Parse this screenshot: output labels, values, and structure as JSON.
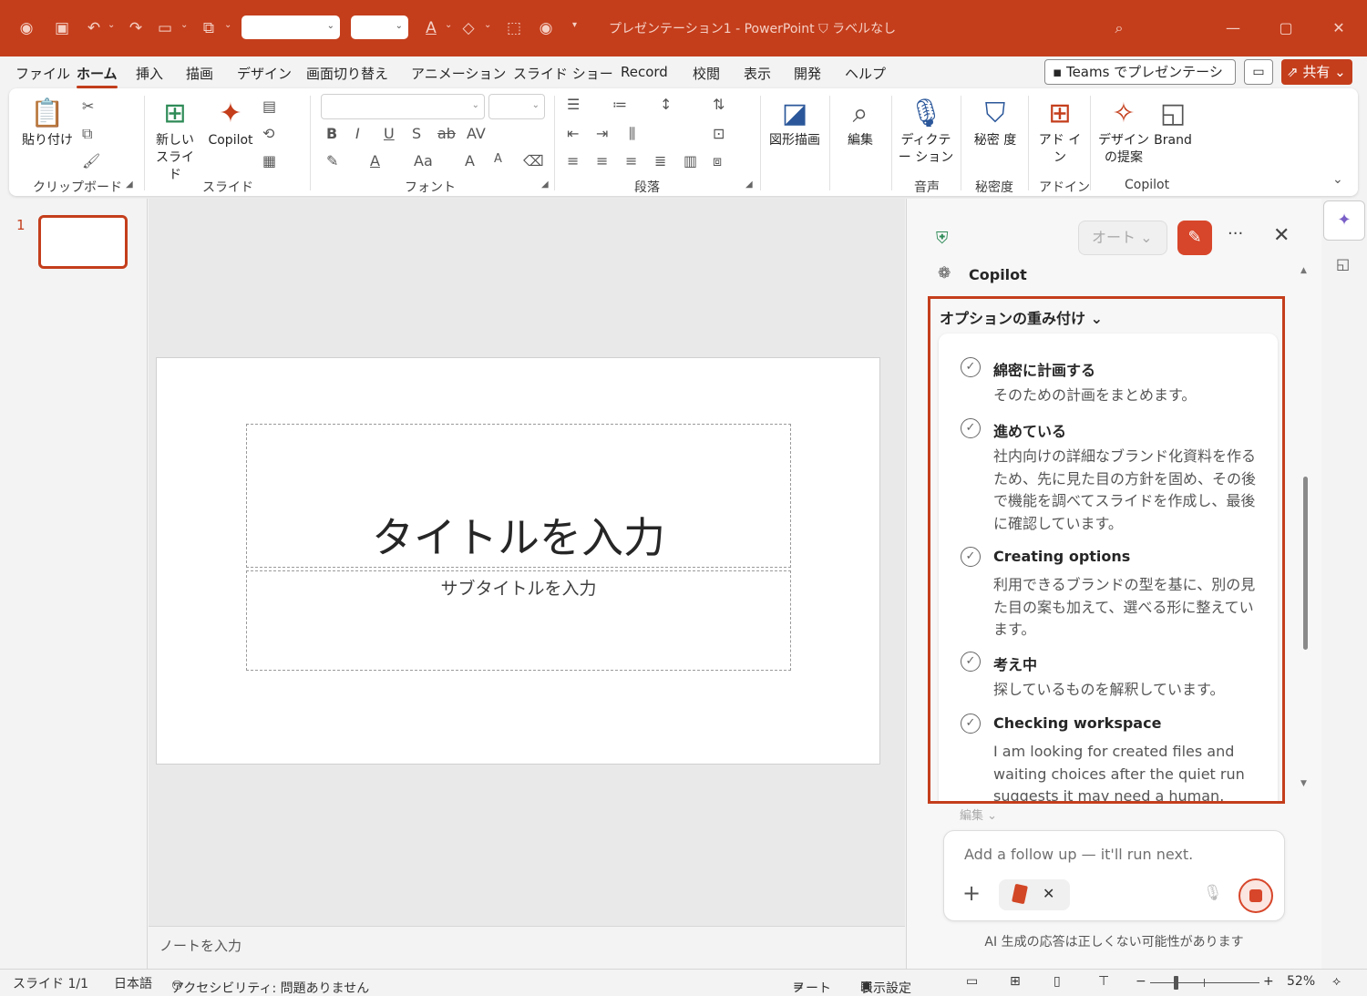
{
  "window": {
    "doc_title": "プレゼンテーション1 - PowerPoint",
    "sensitivity_label": "ラベルなし",
    "brand_color": "#c43e1c"
  },
  "tabs": [
    "ファイル",
    "ホーム",
    "挿入",
    "描画",
    "デザイン",
    "画面切り替え",
    "アニメーション",
    "スライド ショー",
    "Record",
    "校閲",
    "表示",
    "開発",
    "ヘルプ"
  ],
  "active_tab": "ホーム",
  "top_right": {
    "teams_label": "Teams でプレゼンテーション",
    "share_label": "共有"
  },
  "ribbon": {
    "paste_label": "貼り付け",
    "clipboard_label": "クリップボード",
    "new_slide_label": "新しい スライド",
    "copilot_label": "Copilot",
    "slides_group_label": "スライド",
    "font_group_label": "フォント",
    "paragraph_group_label": "段落",
    "shape_label": "図形描画",
    "edit_label": "編集",
    "dictate_label": "ディクテー ション",
    "voice_group_label": "音声",
    "sensitivity_label": "秘密 度",
    "sensitivity_group_label": "秘密度",
    "addin_label": "アド イン",
    "addin_group_label": "アドイン",
    "design_label": "デザイン の提案",
    "brand_label": "Brand",
    "copilot_group_label": "Copilot",
    "font_buttons": [
      "B",
      "I",
      "U",
      "S",
      "ab",
      "AV",
      "A",
      "Aa",
      "A",
      "A"
    ]
  },
  "thumbnail": {
    "number": "1"
  },
  "slide": {
    "title_placeholder": "タイトルを入力",
    "subtitle_placeholder": "サブタイトルを入力"
  },
  "notes_placeholder": "ノートを入力",
  "copilot": {
    "mode_label": "オート",
    "name": "Copilot",
    "options_header": "オプションの重み付け",
    "steps": [
      {
        "title": "綿密に計画する",
        "desc": "そのための計画をまとめます。"
      },
      {
        "title": "進めている",
        "desc": "社内向けの詳細なブランド化資料を作るため、先に見た目の方針を固め、その後で機能を調べてスライドを作成し、最後に確認しています。"
      },
      {
        "title": "Creating options",
        "desc": "利用できるブランドの型を基に、別の見た目の案も加えて、選べる形に整えています。"
      },
      {
        "title": "考え中",
        "desc": "探しているものを解釈しています。"
      },
      {
        "title": "Checking workspace",
        "desc": "I am looking for created files and waiting choices after the quiet run suggests it may need a human."
      }
    ],
    "edit_link": "編集",
    "followup_placeholder": "Add a follow up — it'll run next.",
    "disclaimer": "AI 生成の応答は正しくない可能性があります"
  },
  "status": {
    "slide_count": "スライド 1/1",
    "language": "日本語",
    "accessibility": "アクセシビリティ: 問題ありません",
    "notes_btn": "ノート",
    "display_settings": "表示設定",
    "zoom": "52%"
  }
}
